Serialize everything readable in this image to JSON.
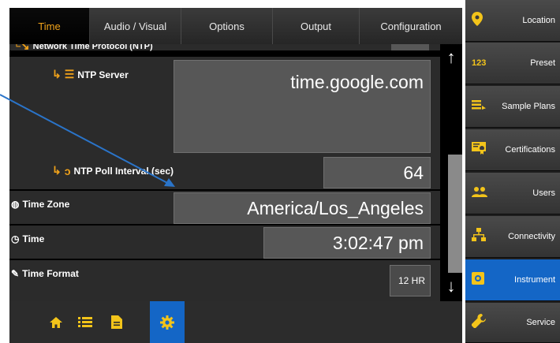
{
  "tabs": [
    {
      "label": "Time",
      "active": true
    },
    {
      "label": "Audio / Visual",
      "active": false
    },
    {
      "label": "Options",
      "active": false
    },
    {
      "label": "Output",
      "active": false
    },
    {
      "label": "Configuration",
      "active": false
    }
  ],
  "settings": {
    "ntp_header": "Network Time Protocol (NTP)",
    "ntp_server": {
      "label": "NTP Server",
      "value": "time.google.com"
    },
    "ntp_poll": {
      "label": "NTP Poll Interval (sec)",
      "value": "64"
    },
    "time_zone": {
      "label": "Time Zone",
      "value": "America/Los_Angeles"
    },
    "time": {
      "label": "Time",
      "value": "3:02:47 pm"
    },
    "time_format": {
      "label": "Time Format",
      "value": "12 HR"
    }
  },
  "sidebar": [
    {
      "label": "Location",
      "icon": "location-pin-icon"
    },
    {
      "label": "Preset",
      "icon": "123-icon"
    },
    {
      "label": "Sample Plans",
      "icon": "list-arrow-icon"
    },
    {
      "label": "Certifications",
      "icon": "certificate-icon"
    },
    {
      "label": "Users",
      "icon": "users-icon"
    },
    {
      "label": "Connectivity",
      "icon": "network-icon"
    },
    {
      "label": "Instrument",
      "icon": "instrument-icon",
      "active": true
    },
    {
      "label": "Service",
      "icon": "wrench-icon"
    }
  ],
  "bottom_bar": [
    {
      "icon": "home-icon"
    },
    {
      "icon": "list-icon"
    },
    {
      "icon": "document-icon"
    },
    {
      "icon": "gear-icon",
      "active": true
    }
  ],
  "colors": {
    "accent": "#f0a21a",
    "active_blue": "#1466c6",
    "value_bg": "#575757"
  }
}
